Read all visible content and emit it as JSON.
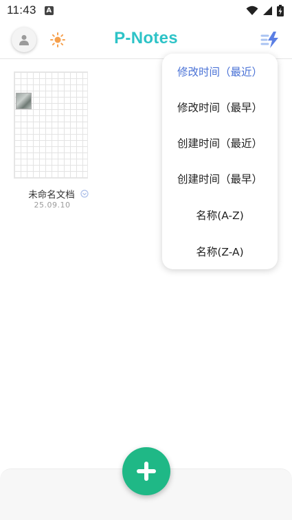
{
  "status_bar": {
    "time": "11:43",
    "notification_icon": "a-notification-icon",
    "wifi_icon": "wifi-icon",
    "signal_icon": "cellular-signal-icon",
    "battery_icon": "battery-charging-icon"
  },
  "header": {
    "title": "P-Notes",
    "title_color": "#2dc3c7",
    "avatar_icon": "user-icon",
    "theme_icon": "sun-icon",
    "sort_icon": "sort-lightning-icon"
  },
  "notes": [
    {
      "title": "未命名文档",
      "date": "25.09.10",
      "status_icon": "chevron-down-circle-icon"
    }
  ],
  "sort_menu": {
    "items": [
      {
        "label": "修改时间（最近）",
        "selected": true
      },
      {
        "label": "修改时间（最早）",
        "selected": false
      },
      {
        "label": "创建时间（最近）",
        "selected": false
      },
      {
        "label": "创建时间（最早）",
        "selected": false
      },
      {
        "label": "名称(A-Z)",
        "selected": false
      },
      {
        "label": "名称(Z-A)",
        "selected": false
      }
    ],
    "selected_color": "#4a72d6"
  },
  "fab": {
    "icon": "plus-icon",
    "color": "#1fb886"
  }
}
